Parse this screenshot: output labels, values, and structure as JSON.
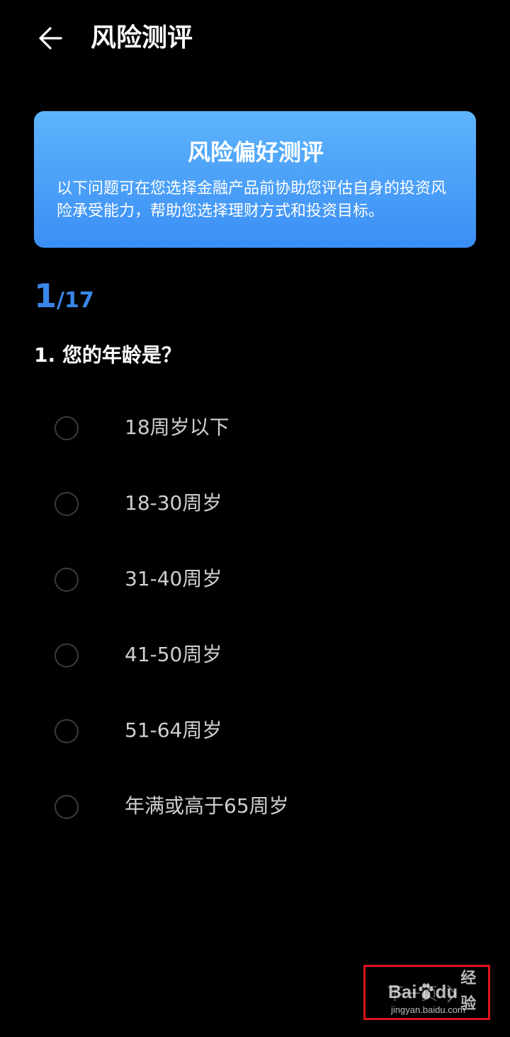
{
  "header": {
    "title": "风险测评",
    "back_icon": "arrow-left-icon"
  },
  "banner": {
    "title": "风险偏好测评",
    "description": "以下问题可在您选择金融产品前协助您评估自身的投资风险承受能力，帮助您选择理财方式和投资目标。",
    "gradient_top": "#5db4fb",
    "gradient_bottom": "#3b8ef5"
  },
  "progress": {
    "current": "1",
    "total": "/17",
    "color": "#3a86e8"
  },
  "question": {
    "text": "1. 您的年龄是？"
  },
  "options": [
    {
      "label": "18周岁以下",
      "selected": false
    },
    {
      "label": "18-30周岁",
      "selected": false
    },
    {
      "label": "31-40周岁",
      "selected": false
    },
    {
      "label": "41-50周岁",
      "selected": false
    },
    {
      "label": "51-64周岁",
      "selected": false
    },
    {
      "label": "年满或高于65周岁",
      "selected": false
    }
  ],
  "footer": {
    "next_label": "下一页",
    "next_icon": "chevron-right-icon",
    "highlight_color": "#d9141a"
  },
  "watermark": {
    "logo_left": "Bai",
    "logo_right": "du",
    "brand": "经验",
    "url": "jingyan.baidu.com"
  }
}
